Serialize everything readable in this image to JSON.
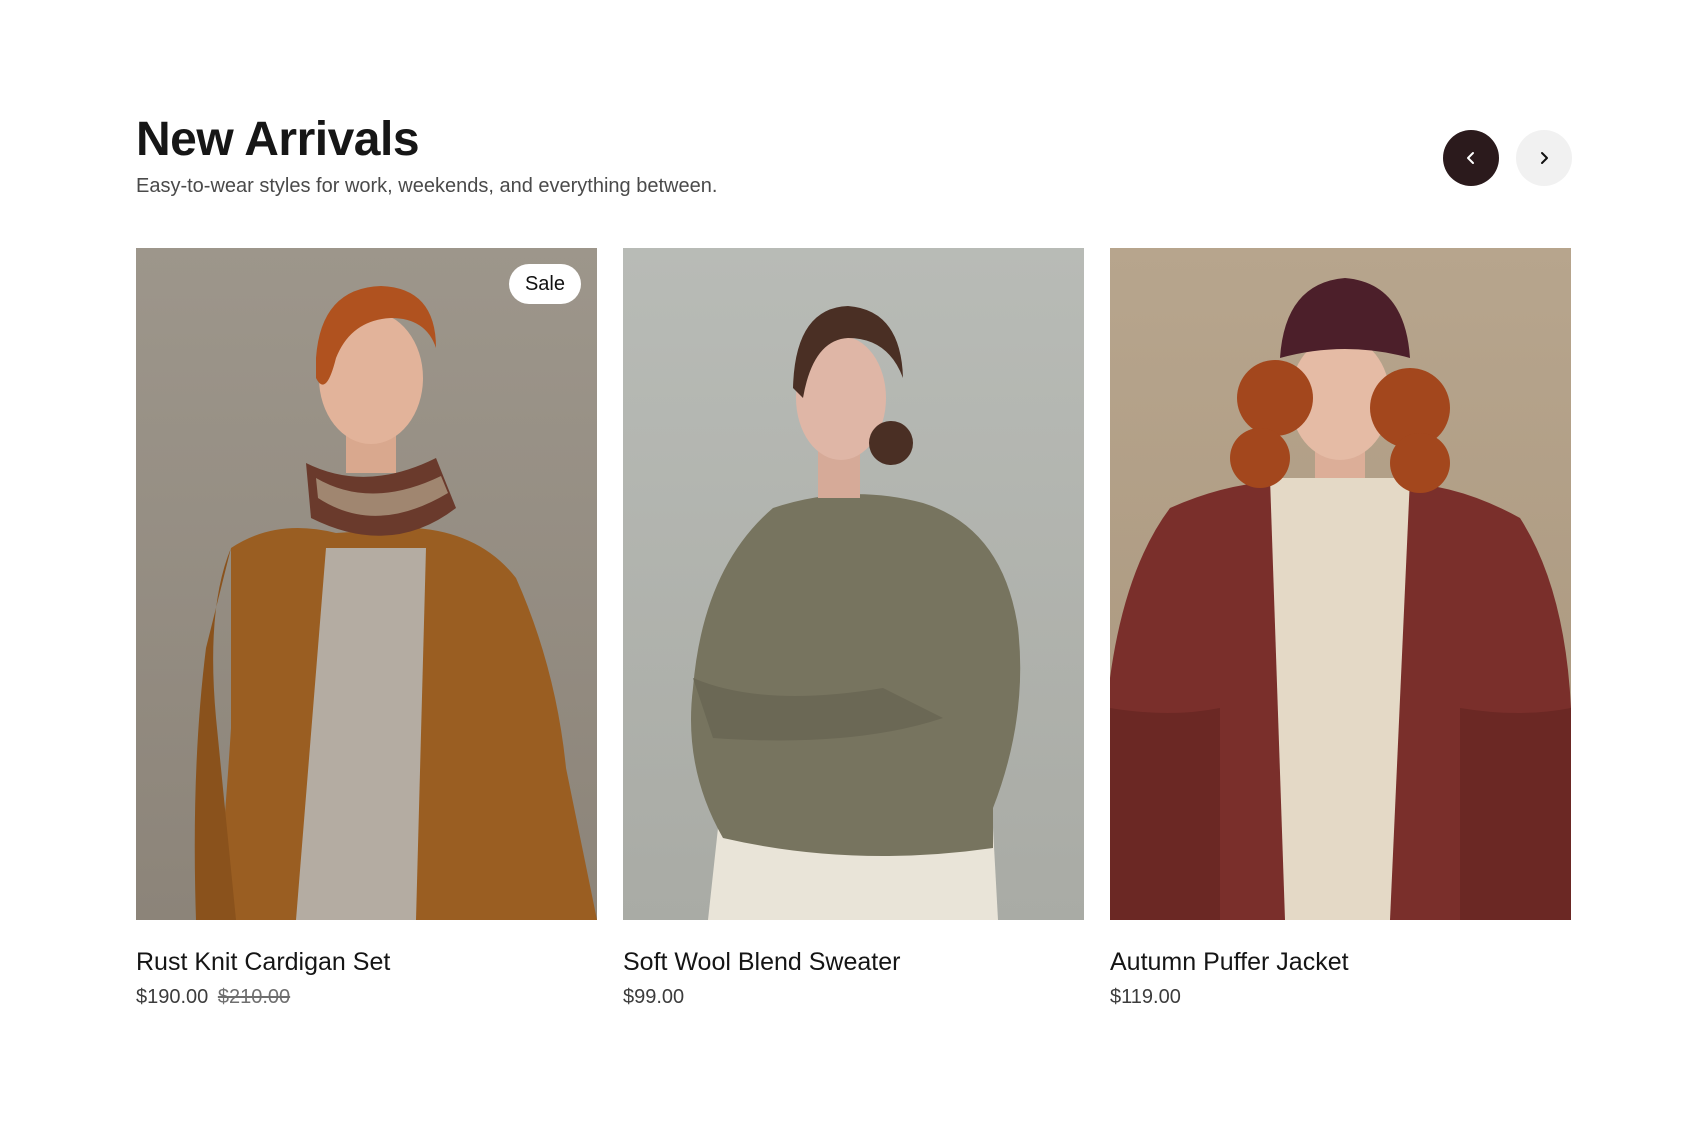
{
  "section": {
    "title": "New Arrivals",
    "subtitle": "Easy-to-wear styles for work, weekends, and everything between."
  },
  "carousel_nav": {
    "prev_icon": "chevron-left-icon",
    "next_icon": "chevron-right-icon"
  },
  "colors": {
    "accent_dark": "#2b1a1c",
    "nav_light": "#f1f1f1",
    "badge_bg": "#ffffff"
  },
  "products": [
    {
      "name": "Rust Knit Cardigan Set",
      "price": "$190.00",
      "compare_price": "$210.00",
      "badge": "Sale",
      "image": "model-rust-knit-cardigan-photo"
    },
    {
      "name": "Soft Wool Blend Sweater",
      "price": "$99.00",
      "compare_price": "",
      "badge": "",
      "image": "model-olive-wool-sweater-photo"
    },
    {
      "name": "Autumn Puffer Jacket",
      "price": "$119.00",
      "compare_price": "",
      "badge": "",
      "image": "model-burgundy-puffer-jacket-photo"
    }
  ]
}
